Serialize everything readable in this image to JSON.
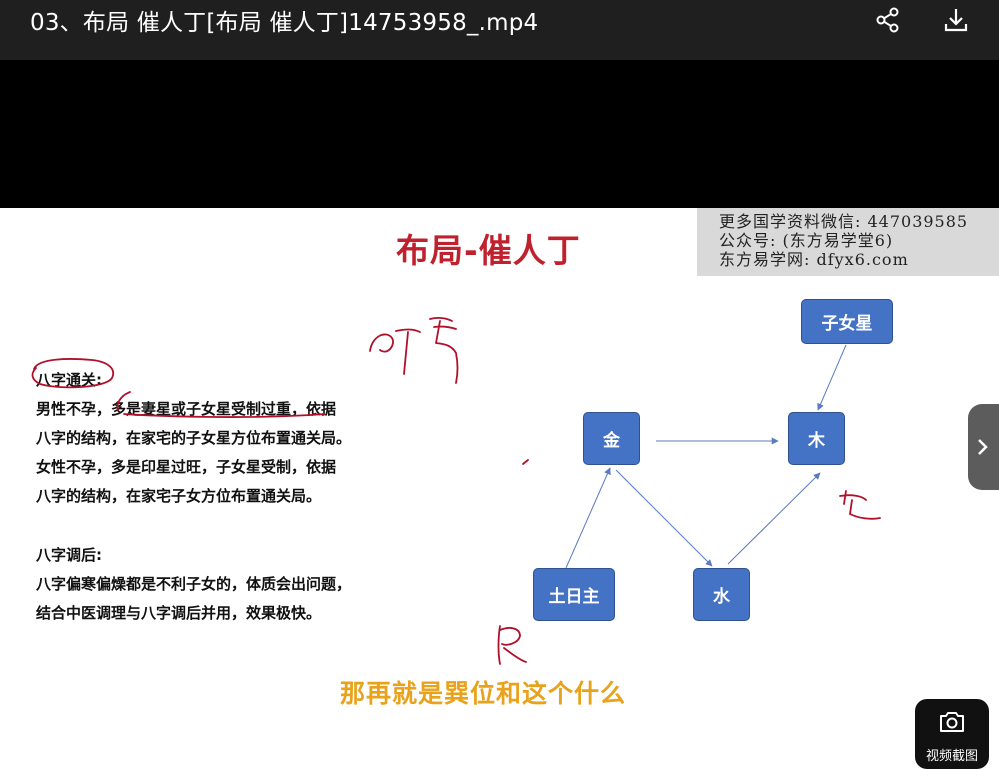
{
  "header": {
    "title": "03、布局 催人丁[布局 催人丁]14753958_.mp4",
    "icons": {
      "share": "share-icon",
      "download": "download-icon"
    }
  },
  "slide": {
    "title": "布局-催人丁",
    "watermark": [
      "更多国学资料微信: 447039585",
      "公众号: (东方易学堂6)",
      "东方易学网: dfyx6.com"
    ],
    "section1": {
      "heading": "八字通关:",
      "lines": [
        "男性不孕，多是妻星或子女星受制过重，依据",
        "八字的结构，在家宅的子女星方位布置通关局。",
        "女性不孕，多是印星过旺，子女星受制，依据",
        "八字的结构，在家宅子女方位布置通关局。"
      ]
    },
    "section2": {
      "heading": "八字调后:",
      "lines": [
        "八字偏寒偏燥都是不利子女的，体质会出问题，",
        "结合中医调理与八字调后并用，效果极快。"
      ]
    },
    "diagram": {
      "nodes": {
        "zinv": "子女星",
        "jin": "金",
        "mu": "木",
        "shui": "水",
        "turizhu": "土日主"
      },
      "node_color": "#4472c4"
    },
    "subtitle": "那再就是巽位和这个什么",
    "colors": {
      "title": "#c0212f",
      "subtitle": "#e8a21c",
      "ink": "#b0102a"
    }
  },
  "overlay": {
    "next_icon": "chevron-right-icon",
    "capture_label": "视频截图",
    "capture_icon": "camera-icon"
  }
}
